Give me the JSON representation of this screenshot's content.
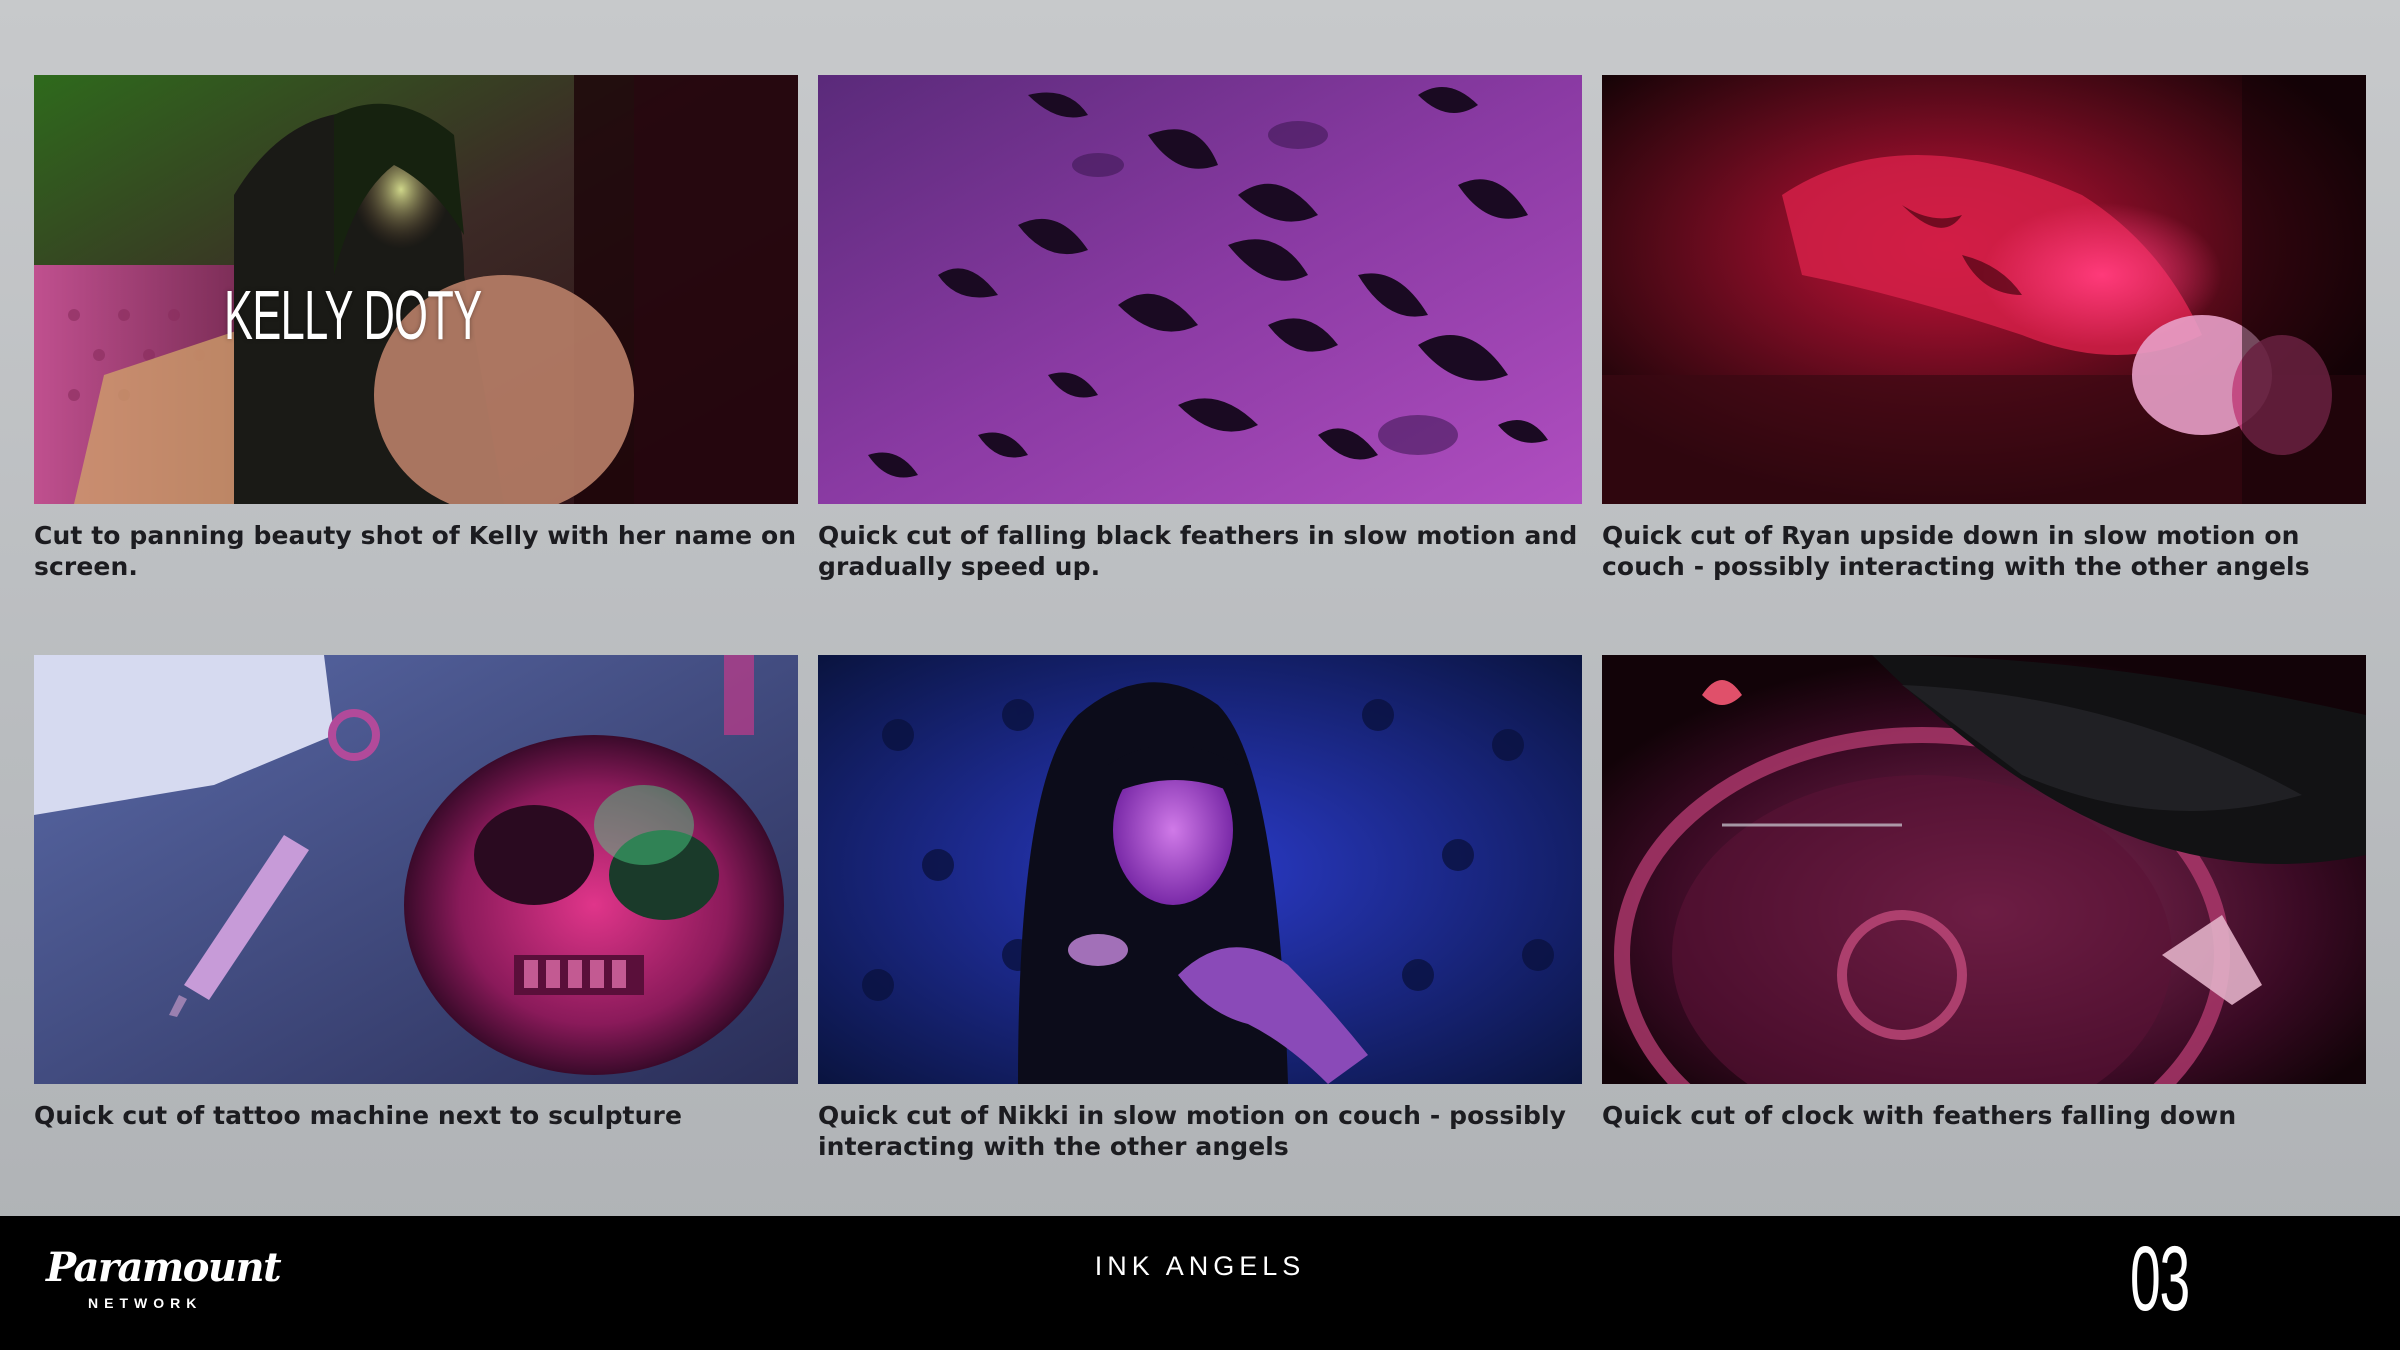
{
  "shots": [
    {
      "overlay_text": "KELLY DOTY",
      "caption": "Cut to panning beauty shot of Kelly with her name on screen."
    },
    {
      "caption": "Quick cut of falling black feathers in slow motion and gradually speed up."
    },
    {
      "caption": "Quick cut of Ryan upside down in slow motion on couch - possibly interacting with the other angels"
    },
    {
      "caption": "Quick cut of tattoo machine next to sculpture"
    },
    {
      "caption": "Quick cut of Nikki in slow motion on couch - possibly interacting with the other angels"
    },
    {
      "caption": "Quick cut of clock with feathers falling down"
    }
  ],
  "footer": {
    "brand": "Paramount",
    "brand_sub": "NETWORK",
    "show_title": "INK ANGELS",
    "page_number": "03"
  },
  "colors": {
    "footer_background": "#000000",
    "caption_text": "#1c1c20",
    "page_background": "#c7c9cb"
  }
}
